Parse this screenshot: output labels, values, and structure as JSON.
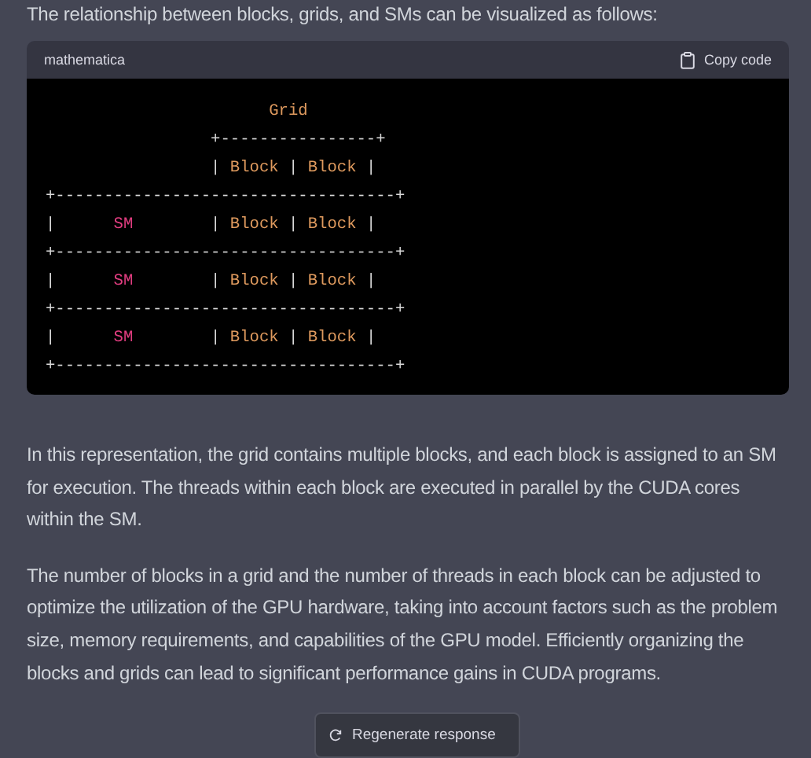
{
  "intro": "The relationship between blocks, grids, and SMs can be visualized as follows:",
  "code_block": {
    "language": "mathematica",
    "copy_label": "Copy code",
    "lines": [
      [
        {
          "text": "                       Grid",
          "kind": "name"
        }
      ],
      [
        {
          "text": "                 +----------------+",
          "kind": "plain"
        }
      ],
      [
        {
          "text": "                 | ",
          "kind": "plain"
        },
        {
          "text": "Block",
          "kind": "name"
        },
        {
          "text": " | ",
          "kind": "plain"
        },
        {
          "text": "Block",
          "kind": "name"
        },
        {
          "text": " |",
          "kind": "plain"
        }
      ],
      [
        {
          "text": "+-----------------------------------+",
          "kind": "plain"
        }
      ],
      [
        {
          "text": "|      ",
          "kind": "plain"
        },
        {
          "text": "SM",
          "kind": "keyword"
        },
        {
          "text": "        | ",
          "kind": "plain"
        },
        {
          "text": "Block",
          "kind": "name"
        },
        {
          "text": " | ",
          "kind": "plain"
        },
        {
          "text": "Block",
          "kind": "name"
        },
        {
          "text": " |",
          "kind": "plain"
        }
      ],
      [
        {
          "text": "+-----------------------------------+",
          "kind": "plain"
        }
      ],
      [
        {
          "text": "|      ",
          "kind": "plain"
        },
        {
          "text": "SM",
          "kind": "keyword"
        },
        {
          "text": "        | ",
          "kind": "plain"
        },
        {
          "text": "Block",
          "kind": "name"
        },
        {
          "text": " | ",
          "kind": "plain"
        },
        {
          "text": "Block",
          "kind": "name"
        },
        {
          "text": " |",
          "kind": "plain"
        }
      ],
      [
        {
          "text": "+-----------------------------------+",
          "kind": "plain"
        }
      ],
      [
        {
          "text": "|      ",
          "kind": "plain"
        },
        {
          "text": "SM",
          "kind": "keyword"
        },
        {
          "text": "        | ",
          "kind": "plain"
        },
        {
          "text": "Block",
          "kind": "name"
        },
        {
          "text": " | ",
          "kind": "plain"
        },
        {
          "text": "Block",
          "kind": "name"
        },
        {
          "text": " |",
          "kind": "plain"
        }
      ],
      [
        {
          "text": "+-----------------------------------+",
          "kind": "plain"
        }
      ]
    ]
  },
  "paragraphs": [
    "In this representation, the grid contains multiple blocks, and each block is assigned to an SM for execution. The threads within each block are executed in parallel by the CUDA cores within the SM.",
    "The number of blocks in a grid and the number of threads in each block can be adjusted to optimize the utilization of the GPU hardware, taking into account factors such as the problem size, memory requirements, and capabilities of the GPU model. Efficiently organizing the blocks and grids can lead to significant performance gains in CUDA programs."
  ],
  "regenerate_button": "Regenerate response"
}
